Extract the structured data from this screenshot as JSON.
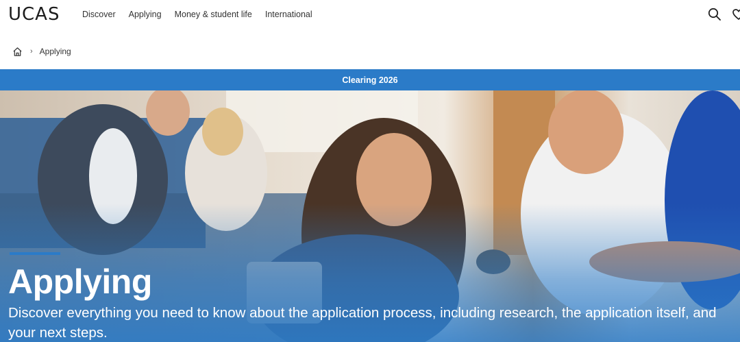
{
  "header": {
    "logo": "UCAS",
    "nav": [
      "Discover",
      "Applying",
      "Money & student life",
      "International"
    ],
    "icons": [
      "search-icon",
      "heart-icon"
    ]
  },
  "breadcrumb": {
    "home_icon": "home-icon",
    "separator": "›",
    "current": "Applying"
  },
  "banner": {
    "label": "Clearing 2026",
    "color": "#2b7bc8"
  },
  "hero": {
    "title": "Applying",
    "subtitle": "Discover everything you need to know about the application process, including research, the application itself, and your next steps."
  }
}
